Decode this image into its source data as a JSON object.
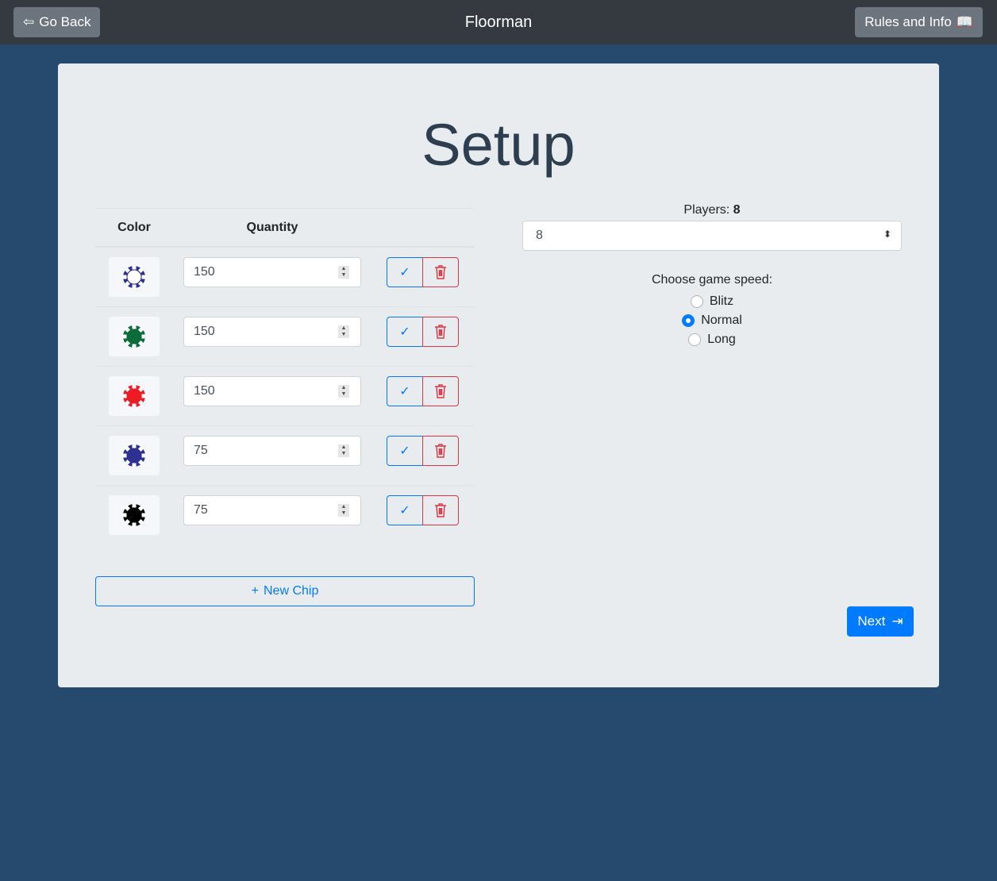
{
  "nav": {
    "back": "Go Back",
    "title": "Floorman",
    "rules": "Rules and Info"
  },
  "page": {
    "title": "Setup"
  },
  "table": {
    "headers": [
      "Color",
      "Quantity"
    ],
    "rows": [
      {
        "color": "#ffffff",
        "edge": "#2e3192",
        "quantity": "150"
      },
      {
        "color": "#0b6b3a",
        "edge": "#0b6b3a",
        "quantity": "150"
      },
      {
        "color": "#ed1c24",
        "edge": "#ed1c24",
        "quantity": "150"
      },
      {
        "color": "#2e3192",
        "edge": "#2e3192",
        "quantity": "75"
      },
      {
        "color": "#000000",
        "edge": "#000000",
        "quantity": "75"
      }
    ]
  },
  "new_chip": "New Chip",
  "players": {
    "label": "Players:",
    "value": "8",
    "selected": "8"
  },
  "speed": {
    "label": "Choose game speed:",
    "options": [
      {
        "label": "Blitz",
        "checked": false
      },
      {
        "label": "Normal",
        "checked": true
      },
      {
        "label": "Long",
        "checked": false
      }
    ]
  },
  "next": "Next"
}
